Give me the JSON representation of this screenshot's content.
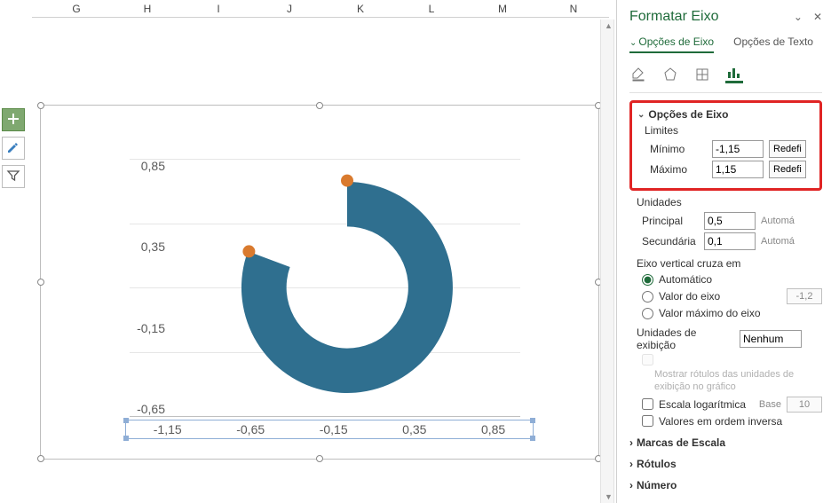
{
  "columns": [
    "G",
    "H",
    "I",
    "J",
    "K",
    "L",
    "M",
    "N"
  ],
  "panel": {
    "title": "Formatar Eixo",
    "tabs": {
      "axis": "Opções de Eixo",
      "text": "Opções de Texto"
    },
    "section_axis": "Opções de Eixo",
    "limits": {
      "label": "Limites",
      "min_label": "Mínimo",
      "min_value": "-1,15",
      "max_label": "Máximo",
      "max_value": "1,15",
      "reset": "Redefi"
    },
    "units": {
      "label": "Unidades",
      "principal_label": "Principal",
      "principal_value": "0,5",
      "secondary_label": "Secundária",
      "secondary_value": "0,1",
      "auto": "Automá"
    },
    "vcross": {
      "label": "Eixo vertical cruza em",
      "auto": "Automático",
      "value": "Valor do eixo",
      "value_num": "-1,2",
      "max": "Valor máximo do eixo"
    },
    "display_units": {
      "label": "Unidades de exibição",
      "value": "Nenhum",
      "show_labels": "Mostrar rótulos das unidades de exibição no gráfico"
    },
    "log": {
      "label": "Escala logarítmica",
      "base_label": "Base",
      "base_value": "10"
    },
    "reverse": "Valores em ordem inversa",
    "tick_marks": "Marcas de Escala",
    "labels": "Rótulos",
    "number": "Número"
  },
  "chart_data": {
    "type": "other",
    "y_ticks": [
      "0,85",
      "0,35",
      "-0,15",
      "-0,65"
    ],
    "x_ticks": [
      "-1,15",
      "-0,65",
      "-0,15",
      "0,35",
      "0,85"
    ],
    "y_axis": {
      "min": -1.15,
      "max": 1.15,
      "major": 0.5,
      "minor": 0.1
    },
    "x_axis": {
      "min": -1.15,
      "max": 1.15,
      "major": 0.5
    },
    "arc": {
      "description": "thick donut arc segment",
      "color": "#2f6f8f",
      "inner_radius_rel": 0.33,
      "outer_radius_rel": 0.9,
      "start_angle_deg": 0,
      "end_angle_deg": 290,
      "endpoint_markers_color": "#d97a2e"
    }
  }
}
